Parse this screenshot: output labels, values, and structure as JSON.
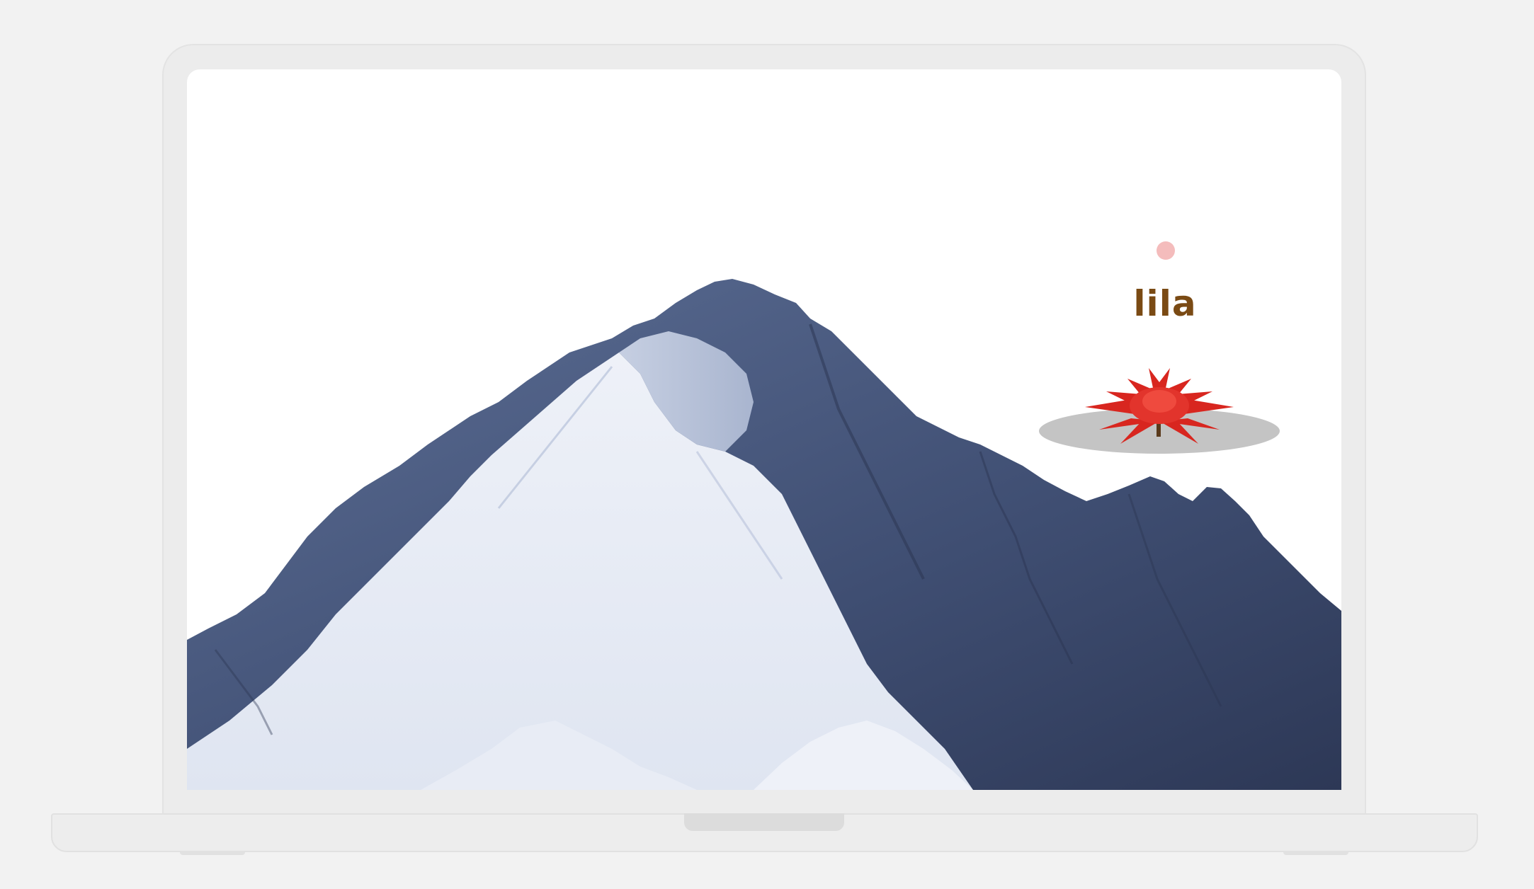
{
  "brand": {
    "name": "lila",
    "dot_color": "#f4bcbc",
    "name_color": "#7a4a14",
    "flower_icon": "red-lotus-icon",
    "flower_color": "#d8261f"
  },
  "scene": {
    "background_image": "snowy-mountain-icon"
  }
}
